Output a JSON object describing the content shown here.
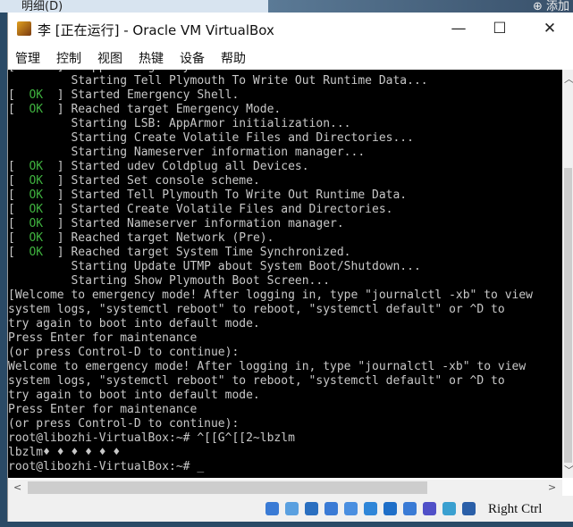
{
  "background": {
    "tab_label": "明细(D)",
    "add_label": "⊕ 添加"
  },
  "window": {
    "title": "李 [正在运行] - Oracle VM VirtualBox",
    "minimize": "—",
    "maximize": "☐",
    "close": "✕"
  },
  "menu": [
    "管理",
    "控制",
    "视图",
    "热键",
    "设备",
    "帮助"
  ],
  "terminal": {
    "ok_label": "OK",
    "lines": [
      {
        "status": "OK",
        "text": "Stopped target System Initialization."
      },
      {
        "status": null,
        "text": "         Starting Tell Plymouth To Write Out Runtime Data..."
      },
      {
        "status": "OK",
        "text": "Started Emergency Shell."
      },
      {
        "status": "OK",
        "text": "Reached target Emergency Mode."
      },
      {
        "status": null,
        "text": "         Starting LSB: AppArmor initialization..."
      },
      {
        "status": null,
        "text": "         Starting Create Volatile Files and Directories..."
      },
      {
        "status": null,
        "text": "         Starting Nameserver information manager..."
      },
      {
        "status": "OK",
        "text": "Started udev Coldplug all Devices."
      },
      {
        "status": "OK",
        "text": "Started Set console scheme."
      },
      {
        "status": "OK",
        "text": "Started Tell Plymouth To Write Out Runtime Data."
      },
      {
        "status": "OK",
        "text": "Started Create Volatile Files and Directories."
      },
      {
        "status": "OK",
        "text": "Started Nameserver information manager."
      },
      {
        "status": "OK",
        "text": "Reached target Network (Pre)."
      },
      {
        "status": "OK",
        "text": "Reached target System Time Synchronized."
      },
      {
        "status": null,
        "text": "         Starting Update UTMP about System Boot/Shutdown..."
      },
      {
        "status": null,
        "text": "         Starting Show Plymouth Boot Screen..."
      },
      {
        "status": null,
        "text": "[Welcome to emergency mode! After logging in, type \"journalctl -xb\" to view"
      },
      {
        "status": null,
        "text": "system logs, \"systemctl reboot\" to reboot, \"systemctl default\" or ^D to"
      },
      {
        "status": null,
        "text": "try again to boot into default mode."
      },
      {
        "status": null,
        "text": "Press Enter for maintenance"
      },
      {
        "status": null,
        "text": "(or press Control-D to continue):"
      },
      {
        "status": null,
        "text": "Welcome to emergency mode! After logging in, type \"journalctl -xb\" to view"
      },
      {
        "status": null,
        "text": "system logs, \"systemctl reboot\" to reboot, \"systemctl default\" or ^D to"
      },
      {
        "status": null,
        "text": "try again to boot into default mode."
      },
      {
        "status": null,
        "text": "Press Enter for maintenance"
      },
      {
        "status": null,
        "text": "(or press Control-D to continue):"
      },
      {
        "status": null,
        "text": "root@libozhi-VirtualBox:~# ^[[G^[[2~lbzlm"
      },
      {
        "status": null,
        "text": "lbzlm♦ ♦ ♦ ♦ ♦ ♦"
      },
      {
        "status": null,
        "text": "root@libozhi-VirtualBox:~# _"
      }
    ]
  },
  "statusbar": {
    "icons": [
      "hard-disk-icon",
      "optical-drive-icon",
      "audio-icon",
      "network-icon",
      "usb-icon",
      "shared-folders-icon",
      "display-icon",
      "video-capture-icon",
      "cpu-icon",
      "mouse-integration-icon",
      "keyboard-icon"
    ],
    "host_key": "Right Ctrl"
  }
}
